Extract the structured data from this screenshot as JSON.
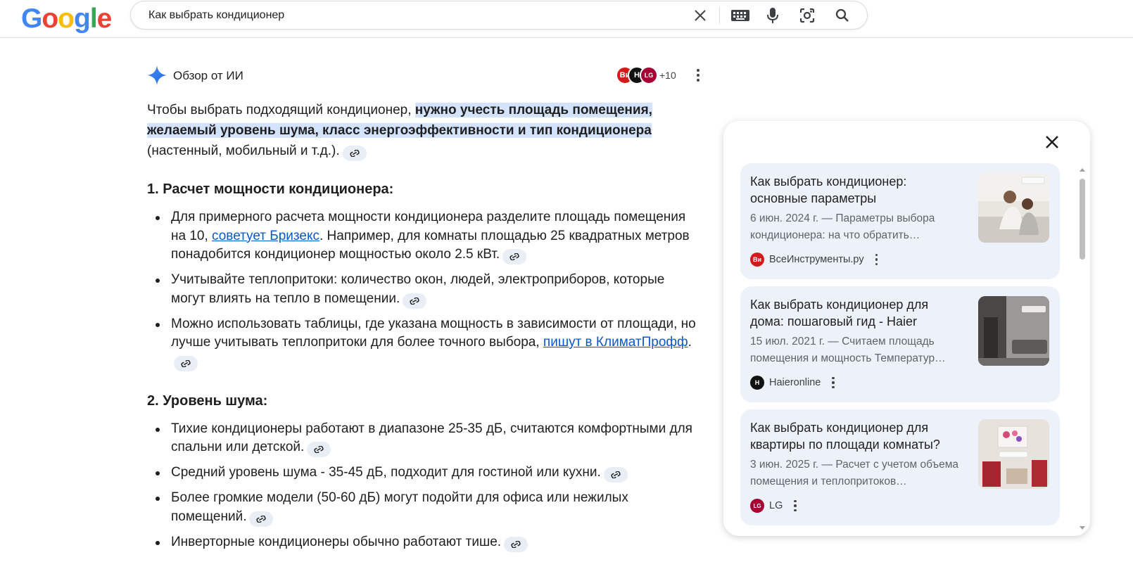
{
  "header": {
    "logo_letters": [
      {
        "ch": "G",
        "color": "#4285f4"
      },
      {
        "ch": "o",
        "color": "#ea4335"
      },
      {
        "ch": "o",
        "color": "#fbbc05"
      },
      {
        "ch": "g",
        "color": "#4285f4"
      },
      {
        "ch": "l",
        "color": "#34a853"
      },
      {
        "ch": "e",
        "color": "#ea4335"
      }
    ],
    "search_query": "Как выбрать кондиционер",
    "icons": [
      "clear-icon",
      "keyboard-icon",
      "mic-icon",
      "lens-icon",
      "search-icon"
    ]
  },
  "ai_overview": {
    "title": "Обзор от ИИ",
    "source_favicons": [
      {
        "label": "Ви",
        "color": "#d11b1b"
      },
      {
        "label": "H",
        "color": "#111111"
      },
      {
        "label": "LG",
        "color": "#a50034"
      }
    ],
    "more_sources": "+10",
    "intro_plain_1": "Чтобы выбрать подходящий кондиционер, ",
    "intro_highlight": "нужно учесть площадь помещения, желаемый уровень шума, класс энергоэффективности и тип кондиционера",
    "intro_plain_2": " (настенный, мобильный и т.д.).",
    "section1": {
      "heading": "1. Расчет мощности кондиционера:",
      "item1_a": "Для примерного расчета мощности кондиционера разделите площадь помещения на 10, ",
      "item1_link": "советует Бризекс",
      "item1_b": ". Например, для комнаты площадью 25 квадратных метров понадобится кондиционер мощностью около 2.5 кВт.",
      "item2": "Учитывайте теплопритоки: количество окон, людей, электроприборов, которые могут влиять на тепло в помещении.",
      "item3_a": "Можно использовать таблицы, где указана мощность в зависимости от площади, но лучше учитывать теплопритоки для более точного выбора, ",
      "item3_link": "пишут в КлиматПрофф",
      "item3_b": "."
    },
    "section2": {
      "heading": "2. Уровень шума:",
      "item1": "Тихие кондиционеры работают в диапазоне 25-35 дБ, считаются комфортными для спальни или детской.",
      "item2": "Средний уровень шума - 35-45 дБ, подходит для гостиной или кухни.",
      "item3": "Более громкие модели (50-60 дБ) могут подойти для офиса или нежилых помещений.",
      "item4": "Инверторные кондиционеры обычно работают тише."
    }
  },
  "side_panel": {
    "cards": [
      {
        "title": "Как выбрать кондиционер: основные параметры",
        "snippet": "6 июн. 2024 г. — Параметры выбора кондиционера: на что обратить…",
        "source": "ВсеИнструменты.ру",
        "favicon_label": "Ви",
        "favicon_color": "#d11b1b"
      },
      {
        "title": "Как выбрать кондиционер для дома: пошаговый гид - Haier",
        "snippet": "15 июл. 2021 г. — Считаем площадь помещения и мощность Температур…",
        "source": "Haieronline",
        "favicon_label": "H",
        "favicon_color": "#111111"
      },
      {
        "title": "Как выбрать кондиционер для квартиры по площади комнаты?",
        "snippet": "3 июн. 2025 г. — Расчет с учетом объема помещения и теплопритоков…",
        "source": "LG",
        "favicon_label": "LG",
        "favicon_color": "#a50034"
      }
    ]
  }
}
